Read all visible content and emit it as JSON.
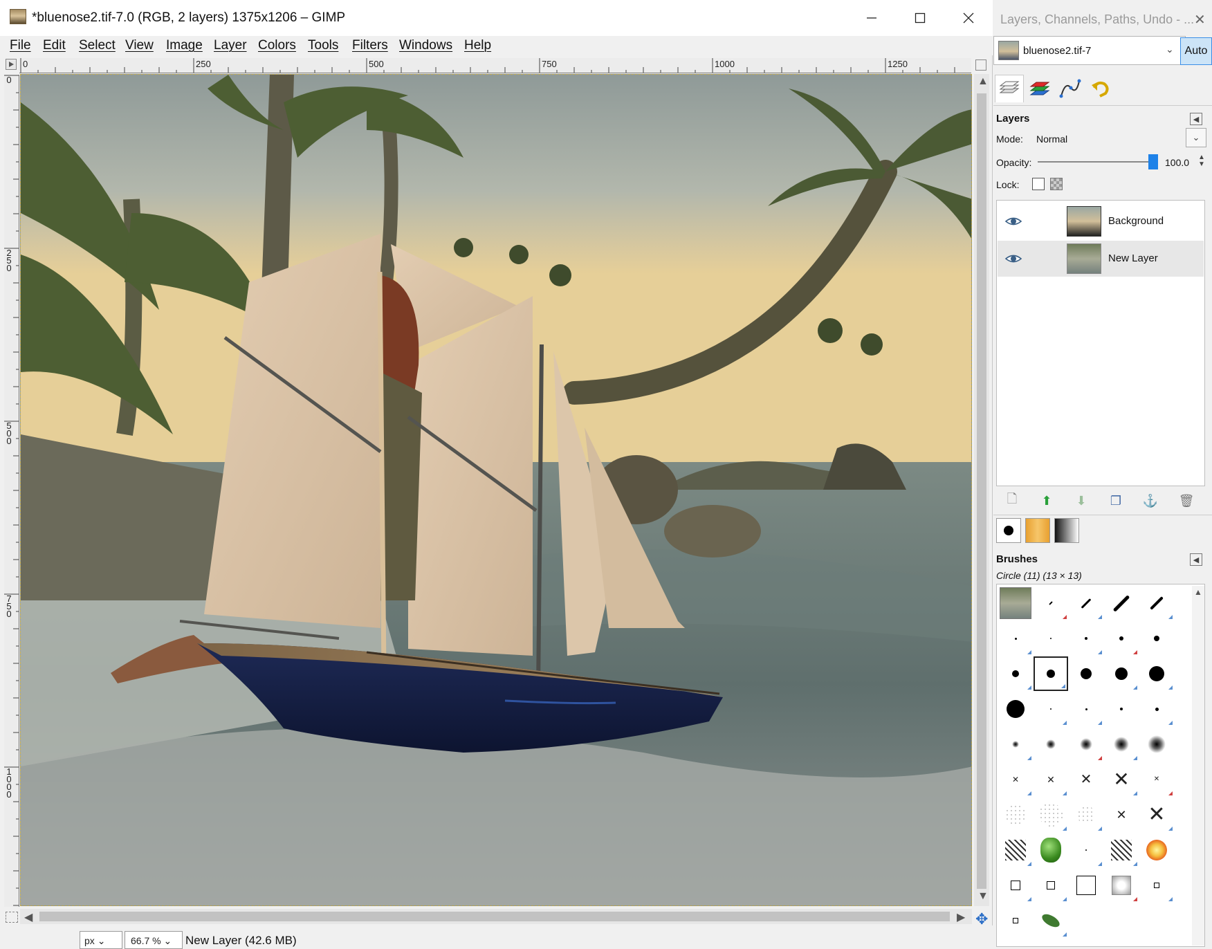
{
  "window": {
    "title": "*bluenose2.tif-7.0 (RGB, 2 layers) 1375x1206 – GIMP",
    "minimize_glyph": "—",
    "maximize_glyph": "☐",
    "close_glyph": "✕"
  },
  "menu": [
    "File",
    "Edit",
    "Select",
    "View",
    "Image",
    "Layer",
    "Colors",
    "Tools",
    "Filters",
    "Windows",
    "Help"
  ],
  "ruler": {
    "top_labels": [
      "0",
      "250",
      "500",
      "750",
      "1000",
      "1250"
    ],
    "left_labels": [
      "0",
      "250",
      "500",
      "750",
      "1000"
    ]
  },
  "statusbar": {
    "unit": "px",
    "zoom": "66.7 %",
    "status": "New Layer (42.6 MB)"
  },
  "dock": {
    "title": "Layers, Channels, Paths, Undo - ...",
    "image_name": "bluenose2.tif-7",
    "auto_label": "Auto",
    "tabs": [
      "layers-tab-icon",
      "channels-tab-icon",
      "paths-tab-icon",
      "undo-tab-icon"
    ]
  },
  "layers": {
    "heading": "Layers",
    "mode_label": "Mode:",
    "mode_value": "Normal",
    "opacity_label": "Opacity:",
    "opacity_value": "100.0",
    "opacity_fraction": 1.0,
    "lock_label": "Lock:",
    "items": [
      {
        "name": "Background",
        "visible": true,
        "selected": false
      },
      {
        "name": "New Layer",
        "visible": true,
        "selected": true
      }
    ],
    "actions": [
      "new-layer-icon",
      "raise-layer-icon",
      "lower-layer-icon",
      "duplicate-layer-icon",
      "anchor-layer-icon",
      "delete-layer-icon"
    ]
  },
  "brushes": {
    "heading": "Brushes",
    "current": "Circle (11) (13 × 13)"
  },
  "colors": {
    "accent": "#1e82e8",
    "canvas_border": "#b7a24a"
  }
}
